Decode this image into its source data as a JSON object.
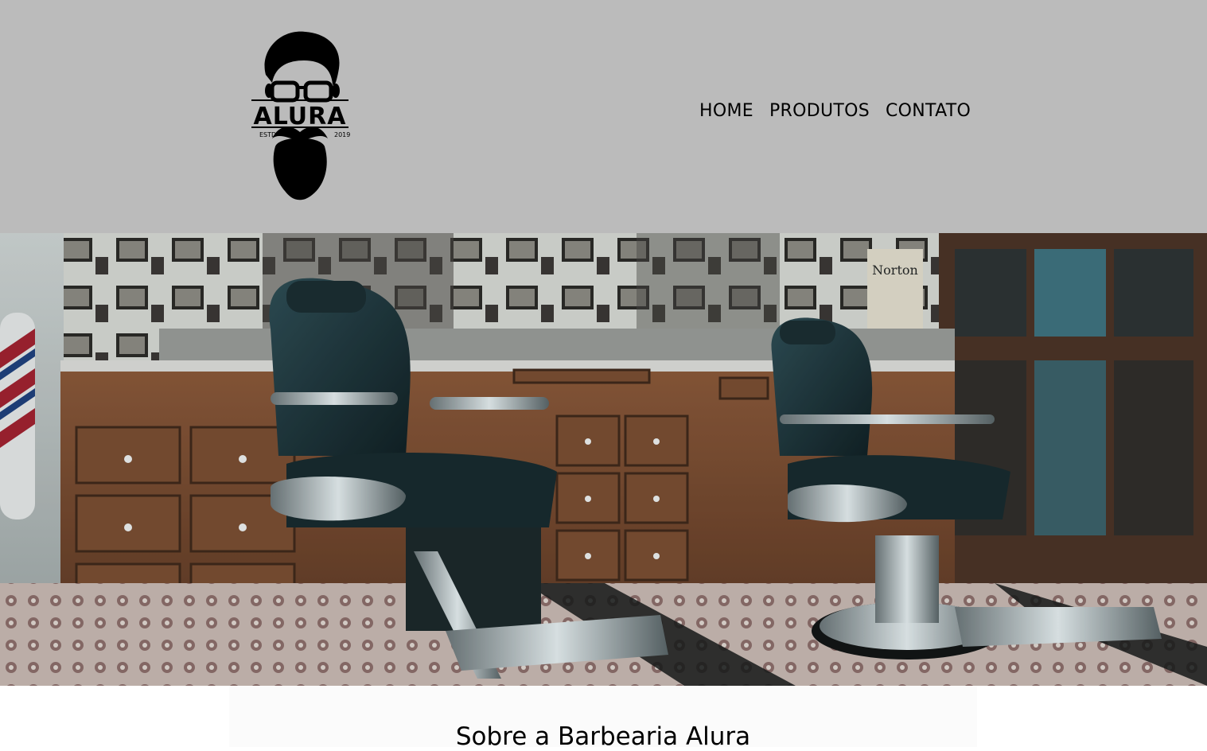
{
  "brand": {
    "logo_text": "ALURA",
    "logo_left": "ESTD",
    "logo_right": "2019"
  },
  "nav": {
    "items": [
      "HOME",
      "PRODUTOS",
      "CONTATO"
    ]
  },
  "hero": {
    "image": "barbershop-interior-photo",
    "sign_text": "Norton"
  },
  "about": {
    "title": "Sobre a Barbearia Alura"
  }
}
